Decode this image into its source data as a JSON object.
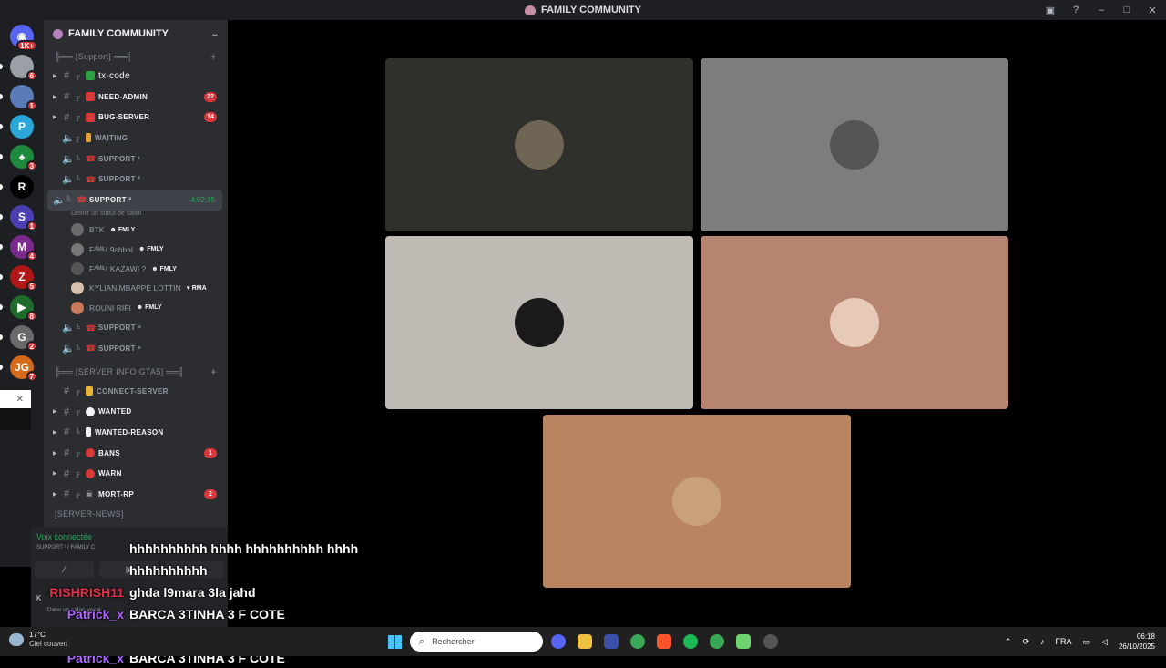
{
  "window": {
    "title": "FAMILY COMMUNITY"
  },
  "servers": [
    {
      "icon": "discord-home-icon",
      "badge": "1K+"
    },
    {
      "icon": "server-avatar-icon",
      "badge": "6"
    },
    {
      "icon": "server-avatar-icon",
      "badge": "1"
    },
    {
      "icon": "server-p-icon",
      "badge": ""
    },
    {
      "icon": "server-palm-icon",
      "badge": "3"
    },
    {
      "icon": "server-r-icon",
      "badge": ""
    },
    {
      "icon": "server-sd-icon",
      "badge": "1"
    },
    {
      "icon": "server-m-icon",
      "badge": "4"
    },
    {
      "icon": "server-z-icon",
      "badge": "5"
    },
    {
      "icon": "server-green-icon",
      "badge": "8"
    },
    {
      "icon": "server-gs-icon",
      "badge": "2"
    },
    {
      "icon": "server-jg-icon",
      "badge": "7"
    }
  ],
  "sidebar": {
    "guild_name": "FAMILY COMMUNITY",
    "categories": {
      "support": "╠══ [Support] ══╣",
      "server_info": "╠══ [SERVER INFO GTA5] ══╣",
      "server_news": "[SERVER-NEWS]"
    },
    "channels": [
      {
        "name": "tx-code",
        "count": ""
      },
      {
        "name": "NEED-ADMIN",
        "count": "22"
      },
      {
        "name": "BUG-SERVER",
        "count": "14"
      },
      {
        "name": "WAITING",
        "count": ""
      },
      {
        "name": "SUPPORT ¹",
        "count": ""
      },
      {
        "name": "SUPPORT ²",
        "count": ""
      },
      {
        "name": "SUPPORT ³",
        "count": ""
      },
      {
        "name": "SUPPORT ⁴",
        "count": ""
      },
      {
        "name": "SUPPORT ⁵",
        "count": ""
      },
      {
        "name": "CONNECT-SERVER",
        "count": ""
      },
      {
        "name": "WANTED",
        "count": ""
      },
      {
        "name": "WANTED-REASON",
        "count": ""
      },
      {
        "name": "BANS",
        "count": "1"
      },
      {
        "name": "WARN",
        "count": ""
      },
      {
        "name": "MORT-RP",
        "count": "2"
      }
    ],
    "active_timer": "4:02:35",
    "active_status": "Définir un statut de salon",
    "members": [
      {
        "name": "BTK",
        "tag": "FMLY"
      },
      {
        "name": "Fᴬᴹᴵᴸʸ 9chbal",
        "tag": "FMLY"
      },
      {
        "name": "Fᴬᴹᴵᴸʸ KAZAWI ?",
        "tag": "FMLY"
      },
      {
        "name": "KYLIAN MBAPPE LOTTIN",
        "tag": "RMA"
      },
      {
        "name": "ROUNI RIFI",
        "tag": "FMLY"
      }
    ]
  },
  "voice_panel": {
    "connected": "Voix connectée",
    "channel_path": "SUPPORT ³ / FAMILY C",
    "user_initial": "K",
    "user_status": "Dans un salon vocal"
  },
  "tiles": [
    {
      "bg": "#2f2f2b",
      "avatar": "#6e6554"
    },
    {
      "bg": "#7d7d7d",
      "avatar": "#555555"
    },
    {
      "bg": "#bfbbb4",
      "avatar": "#1a1a1a"
    },
    {
      "bg": "#b88472",
      "avatar": "#e6c9b6"
    },
    {
      "bg": "#b98561",
      "avatar": "#c8a07a"
    }
  ],
  "chat_overlay": [
    {
      "user": "",
      "text": "hhhhhhhhhh hhhh hhhhhhhhhh hhhh",
      "color": "#ffffff"
    },
    {
      "user": "",
      "text": "hhhhhhhhhh",
      "color": "#ffffff"
    },
    {
      "user": "RISHRISH11",
      "text": "ghda l9mara 3la jahd",
      "color": "#e0344a"
    },
    {
      "user": "Patrick_x",
      "text": "BARCA 3TINHA 3 F COTE",
      "color": "#b065ff"
    },
    {
      "user": "Patrick_x",
      "text": "BARCA 3TINHA 3 F COTE",
      "color": "#b065ff"
    },
    {
      "user": "Patrick_x",
      "text": "BARCA 3TINHA 3 F COTE",
      "color": "#b065ff"
    }
  ],
  "taskbar": {
    "weather_temp": "17°C",
    "weather_desc": "Ciel couvert",
    "search_placeholder": "Rechercher",
    "lang": "FRA",
    "time": "06:18",
    "date": "26/10/2025"
  }
}
